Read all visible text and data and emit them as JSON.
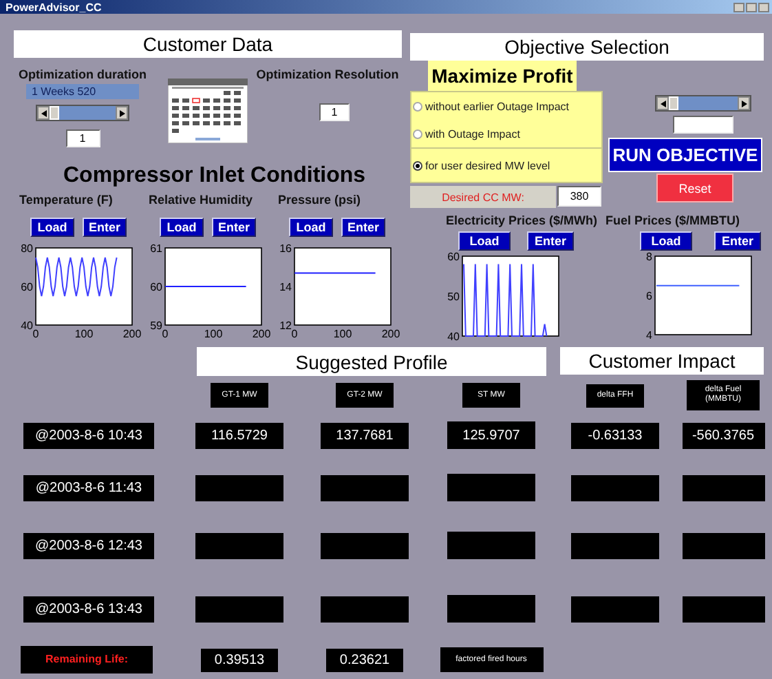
{
  "window": {
    "title": "PowerAdvisor_CC"
  },
  "customer_data": {
    "title": "Customer Data",
    "duration": {
      "label": "Optimization duration",
      "range_min": "1",
      "unit": "Weeks",
      "range_max": "520",
      "level": 0,
      "value": "1"
    },
    "resolution": {
      "label": "Optimization Resolution",
      "value": "1"
    },
    "compressor_title": "Compressor Inlet Conditions",
    "inputs": [
      {
        "label": "Temperature (F)",
        "buttons": [
          "Load",
          "Enter"
        ],
        "chart_data": {
          "type": "line",
          "xlim": [
            0,
            200
          ],
          "ylim": [
            40,
            80
          ],
          "xticks": [
            0,
            100,
            200
          ],
          "yticks": [
            40,
            60,
            80
          ],
          "x": [
            0,
            4,
            8,
            12,
            16,
            20,
            24,
            28,
            32,
            36,
            40,
            44,
            48,
            52,
            56,
            60,
            64,
            68,
            72,
            76,
            80,
            84,
            88,
            92,
            96,
            100,
            104,
            108,
            112,
            116,
            120,
            124,
            128,
            132,
            136,
            140,
            144,
            148,
            152,
            156,
            160,
            164,
            168
          ],
          "series": [
            {
              "color": "#4040ff",
              "values": [
                75,
                70,
                60,
                55,
                60,
                70,
                75,
                70,
                60,
                55,
                60,
                70,
                75,
                70,
                60,
                55,
                60,
                70,
                75,
                70,
                60,
                55,
                60,
                70,
                75,
                70,
                60,
                55,
                60,
                70,
                75,
                70,
                60,
                55,
                60,
                70,
                75,
                70,
                60,
                55,
                60,
                70,
                75
              ]
            }
          ]
        }
      },
      {
        "label": "Relative Humidity",
        "buttons": [
          "Load",
          "Enter"
        ],
        "chart_data": {
          "type": "line",
          "xlim": [
            0,
            200
          ],
          "ylim": [
            59,
            61
          ],
          "xticks": [
            0,
            100,
            200
          ],
          "yticks": [
            59,
            60,
            61
          ],
          "x": [
            0,
            168
          ],
          "series": [
            {
              "color": "#2020ff",
              "values": [
                60,
                60
              ]
            }
          ]
        }
      },
      {
        "label": "Pressure (psi)",
        "buttons": [
          "Load",
          "Enter"
        ],
        "chart_data": {
          "type": "line",
          "xlim": [
            0,
            200
          ],
          "ylim": [
            12,
            16
          ],
          "xticks": [
            0,
            100,
            200
          ],
          "yticks": [
            12,
            14,
            16
          ],
          "x": [
            0,
            168
          ],
          "series": [
            {
              "color": "#2020ff",
              "values": [
                14.7,
                14.7
              ]
            }
          ]
        }
      }
    ]
  },
  "objective": {
    "title": "Objective Selection",
    "tab": "Maximize Profit",
    "options": [
      {
        "label": "without earlier Outage Impact",
        "selected": false
      },
      {
        "label": "with Outage Impact",
        "selected": false
      },
      {
        "label": "for user desired MW level",
        "selected": true
      }
    ],
    "desired": {
      "label": "Desired CC MW:",
      "value": "380"
    },
    "slider": {
      "level": 0
    },
    "run_button": "RUN OBJECTIVE",
    "reset_button": "Reset",
    "prices": [
      {
        "label": "Electricity Prices ($/MWh)",
        "buttons": [
          "Load",
          "Enter"
        ],
        "chart_data": {
          "type": "line",
          "ylim": [
            40,
            60
          ],
          "yticks": [
            40,
            50,
            60
          ],
          "categories": [
            null,
            null,
            null,
            null,
            null,
            null,
            null,
            null,
            null,
            null,
            null,
            null,
            null,
            null,
            null,
            null,
            null,
            null,
            null,
            null,
            null,
            null,
            null,
            null,
            null,
            null,
            null,
            null,
            null,
            null,
            null,
            null,
            null,
            null,
            null,
            null,
            null,
            null,
            null,
            null,
            null,
            null,
            null,
            null
          ],
          "series": [
            {
              "color": "#4040ff",
              "values": [
                58,
                40,
                40,
                40,
                40,
                40,
                58,
                40,
                40,
                40,
                40,
                40,
                58,
                40,
                40,
                40,
                40,
                40,
                58,
                40,
                40,
                40,
                40,
                40,
                58,
                40,
                40,
                40,
                40,
                40,
                58,
                40,
                40,
                40,
                40,
                40,
                58,
                40,
                40,
                40,
                40,
                40,
                43,
                40
              ]
            }
          ]
        }
      },
      {
        "label": "Fuel Prices ($/MMBTU)",
        "buttons": [
          "Load",
          "Enter"
        ],
        "chart_data": {
          "type": "line",
          "ylim": [
            4,
            8
          ],
          "yticks": [
            4,
            6,
            8
          ],
          "categories": [
            null,
            null,
            null,
            null,
            null,
            null,
            null,
            null
          ],
          "series": [
            {
              "color": "#4060ff",
              "values": [
                6.5,
                6.5,
                6.5,
                6.5,
                6.5,
                6.5,
                6.5,
                6.5
              ]
            }
          ]
        }
      }
    ]
  },
  "suggested_profile": {
    "title": "Suggested Profile",
    "columns": [
      "GT-1 MW",
      "GT-2 MW",
      "ST MW"
    ]
  },
  "customer_impact": {
    "title": "Customer Impact",
    "columns": [
      "delta FFH",
      "delta Fuel (MMBTU)"
    ]
  },
  "rows": [
    {
      "time": "@2003-8-6 10:43",
      "values": [
        "116.5729",
        "137.7681",
        "125.9707",
        "-0.63133",
        "-560.3765"
      ]
    },
    {
      "time": "@2003-8-6 11:43"
    },
    {
      "time": "@2003-8-6 12:43"
    },
    {
      "time": "@2003-8-6 13:43"
    }
  ],
  "remaining_life": {
    "label": "Remaining Life:",
    "values": [
      "0.39513",
      "0.23621"
    ],
    "note": "factored fired hours"
  }
}
